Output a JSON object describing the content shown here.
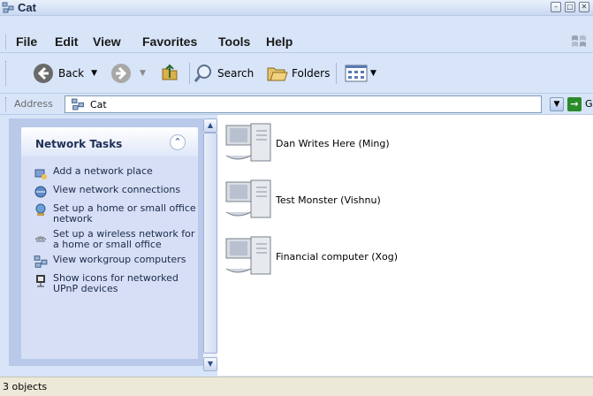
{
  "window": {
    "title": "Cat",
    "controls": {
      "minimize": "–",
      "maximize": "□",
      "close": "✕"
    }
  },
  "menubar": {
    "items": [
      "File",
      "Edit",
      "View",
      "Favorites",
      "Tools",
      "Help"
    ]
  },
  "toolbar": {
    "back": "Back",
    "search": "Search",
    "folders": "Folders"
  },
  "address": {
    "label": "Address",
    "value": "Cat",
    "go": "Go"
  },
  "taskpane": {
    "title": "Network Tasks",
    "tasks": [
      {
        "label": "Add a network place",
        "icon": "network-place-icon"
      },
      {
        "label": "View network connections",
        "icon": "network-connections-icon"
      },
      {
        "label": "Set up a home or small office network",
        "icon": "home-network-icon"
      },
      {
        "label": "Set up a wireless network for a home or small office",
        "icon": "wireless-icon"
      },
      {
        "label": "View workgroup computers",
        "icon": "workgroup-icon"
      },
      {
        "label": "Show icons for networked UPnP devices",
        "icon": "upnp-icon"
      }
    ]
  },
  "computers": [
    {
      "label": "Dan Writes Here (Ming)"
    },
    {
      "label": "Test Monster (Vishnu)"
    },
    {
      "label": "Financial computer (Xog)"
    }
  ],
  "status": {
    "text": "3 objects"
  },
  "colors": {
    "pane": "#b9c9ea",
    "accent": "#1f2f57",
    "go": "#2a8b2a"
  }
}
